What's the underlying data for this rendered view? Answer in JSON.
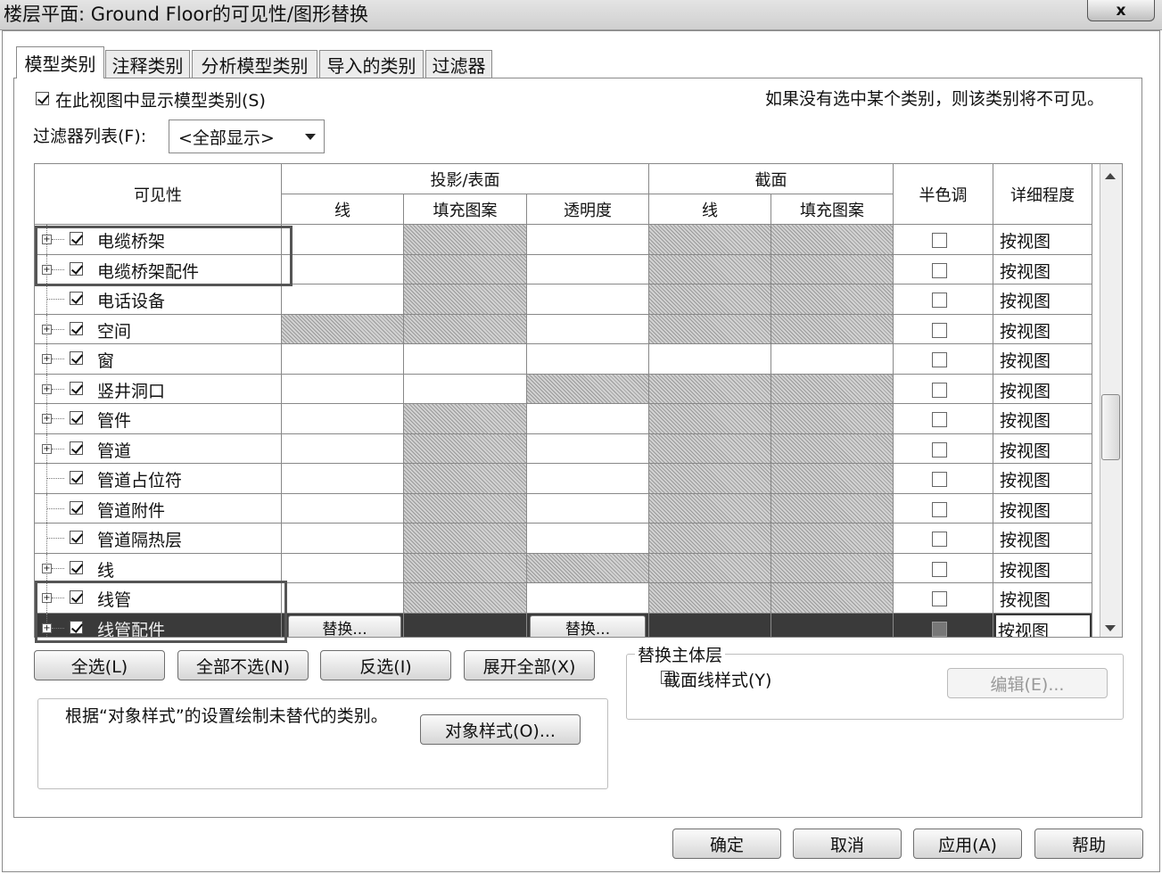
{
  "window": {
    "title": "楼层平面: Ground Floor的可见性/图形替换",
    "close_label": "x"
  },
  "tabs": [
    {
      "label": "模型类别"
    },
    {
      "label": "注释类别"
    },
    {
      "label": "分析模型类别"
    },
    {
      "label": "导入的类别"
    },
    {
      "label": "过滤器"
    }
  ],
  "options": {
    "show_model_label": "在此视图中显示模型类别(S)",
    "show_model_checked": true,
    "hint": "如果没有选中某个类别，则该类别将不可见。",
    "filter_label": "过滤器列表(F):",
    "filter_value": "<全部显示>"
  },
  "grid": {
    "visibility_header": "可见性",
    "projection_header": "投影/表面",
    "cut_header": "截面",
    "halftone_header": "半色调",
    "detail_header": "详细程度",
    "line_header": "线",
    "fill_header": "填充图案",
    "transparency_header": "透明度",
    "cut_line_header": "线",
    "cut_fill_header": "填充图案",
    "override_label": "替换...",
    "rows": [
      {
        "name": "电缆桥架",
        "expandable": true,
        "checked": true,
        "halftone": false,
        "detail": "按视图"
      },
      {
        "name": "电缆桥架配件",
        "expandable": true,
        "checked": true,
        "halftone": false,
        "detail": "按视图"
      },
      {
        "name": "电话设备",
        "expandable": false,
        "checked": true,
        "halftone": false,
        "detail": "按视图"
      },
      {
        "name": "空间",
        "expandable": true,
        "checked": true,
        "halftone": false,
        "detail": "按视图"
      },
      {
        "name": "窗",
        "expandable": true,
        "checked": true,
        "halftone": false,
        "detail": "按视图"
      },
      {
        "name": "竖井洞口",
        "expandable": true,
        "checked": true,
        "halftone": false,
        "detail": "按视图"
      },
      {
        "name": "管件",
        "expandable": true,
        "checked": true,
        "halftone": false,
        "detail": "按视图"
      },
      {
        "name": "管道",
        "expandable": true,
        "checked": true,
        "halftone": false,
        "detail": "按视图"
      },
      {
        "name": "管道占位符",
        "expandable": false,
        "checked": true,
        "halftone": false,
        "detail": "按视图"
      },
      {
        "name": "管道附件",
        "expandable": false,
        "checked": true,
        "halftone": false,
        "detail": "按视图"
      },
      {
        "name": "管道隔热层",
        "expandable": false,
        "checked": true,
        "halftone": false,
        "detail": "按视图"
      },
      {
        "name": "线",
        "expandable": true,
        "checked": true,
        "halftone": false,
        "detail": "按视图"
      },
      {
        "name": "线管",
        "expandable": true,
        "checked": true,
        "halftone": false,
        "detail": "按视图"
      },
      {
        "name": "线管配件",
        "expandable": true,
        "checked": true,
        "halftone": false,
        "detail": "按视图",
        "selected": true
      }
    ]
  },
  "selection_buttons": {
    "select_all": "全选(L)",
    "select_none": "全部不选(N)",
    "invert": "反选(I)",
    "expand_all": "展开全部(X)"
  },
  "host_layers": {
    "title": "替换主体层",
    "cut_line_styles": "截面线样式(Y)",
    "cut_line_styles_checked": false,
    "edit": "编辑(E)..."
  },
  "object_styles": {
    "note": "根据“对象样式”的设置绘制未替代的类别。",
    "button": "对象样式(O)..."
  },
  "footer": {
    "ok": "确定",
    "cancel": "取消",
    "apply": "应用(A)",
    "help": "帮助"
  },
  "colors": {
    "selected_row": "#3a3a3a",
    "hatch": "#9a9a9a",
    "border": "#888888"
  }
}
